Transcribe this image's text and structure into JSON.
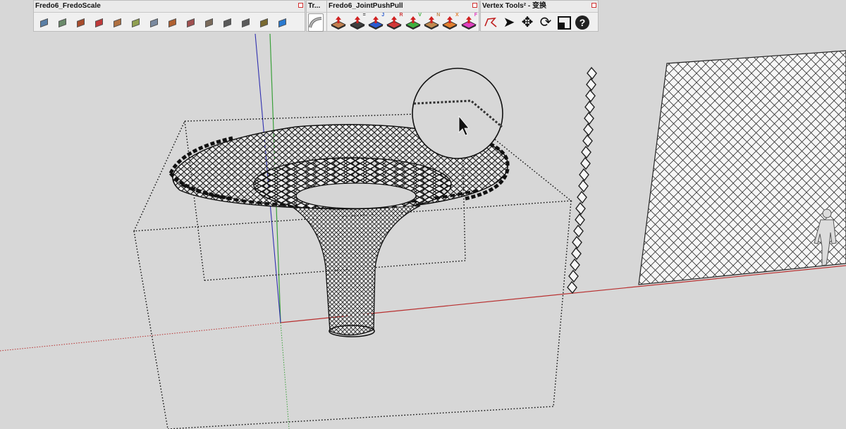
{
  "toolbars": {
    "fredoscale": {
      "title": "Fredo6_FredoScale",
      "buttons": [
        {
          "icon": "box-scale-icon",
          "color": "#5a7fa6"
        },
        {
          "icon": "box-stretch-icon",
          "color": "#6a8a6a"
        },
        {
          "icon": "box-twist-icon",
          "color": "#a84c2c"
        },
        {
          "icon": "box-rotate-icon",
          "color": "#c03a3a"
        },
        {
          "icon": "plane-shear-icon",
          "color": "#b07040"
        },
        {
          "icon": "radial-bend-icon",
          "color": "#90a050"
        },
        {
          "icon": "box-tube-icon",
          "color": "#7a8aa0"
        },
        {
          "icon": "untwist-icon",
          "color": "#b06030"
        },
        {
          "icon": "taper-icon",
          "color": "#a05050"
        },
        {
          "icon": "cube-icon",
          "color": "#7a6a5a"
        },
        {
          "icon": "cube-scale-icon",
          "color": "#5a5a5a"
        },
        {
          "icon": "rotate-icon",
          "color": "#5a5a5a"
        },
        {
          "icon": "pencil-icon",
          "color": "#7a6a30"
        },
        {
          "icon": "curve-icon",
          "color": "#2a7ad0"
        }
      ]
    },
    "truebend": {
      "title": "Tr..."
    },
    "jointpushpull": {
      "title": "Fredo6_JointPushPull",
      "buttons": [
        {
          "icon": "pushpull-icon",
          "color": "#c08050",
          "letter": ""
        },
        {
          "icon": "joint-pushpull-icon",
          "color": "#404040",
          "letter": "="
        },
        {
          "icon": "pushpull-j-icon",
          "color": "#2a5ad0",
          "letter": "J"
        },
        {
          "icon": "pushpull-r-icon",
          "color": "#d03a3a",
          "letter": "R"
        },
        {
          "icon": "pushpull-v-icon",
          "color": "#40b040",
          "letter": "V"
        },
        {
          "icon": "pushpull-n-icon",
          "color": "#c08a50",
          "letter": "N"
        },
        {
          "icon": "pushpull-x-icon",
          "color": "#e08030",
          "letter": "X"
        },
        {
          "icon": "pushpull-f-icon",
          "color": "#e040c0",
          "letter": "F"
        }
      ]
    },
    "vertextools": {
      "title": "Vertex Tools² - 变换",
      "buttons": [
        {
          "icon": "vertex-path-icon",
          "glyph": ""
        },
        {
          "icon": "select-arrow-icon",
          "glyph": "➤"
        },
        {
          "icon": "move-icon",
          "glyph": "✥"
        },
        {
          "icon": "rotate-icon",
          "glyph": "⟳"
        },
        {
          "icon": "scale-icon",
          "glyph": "⤢"
        },
        {
          "icon": "help-icon",
          "glyph": "?"
        }
      ]
    }
  },
  "colors": {
    "background": "#d7d7d7",
    "axis_red": "#b83030",
    "axis_green": "#3aa03a",
    "axis_blue": "#3030b0",
    "wireframe": "#111111"
  }
}
